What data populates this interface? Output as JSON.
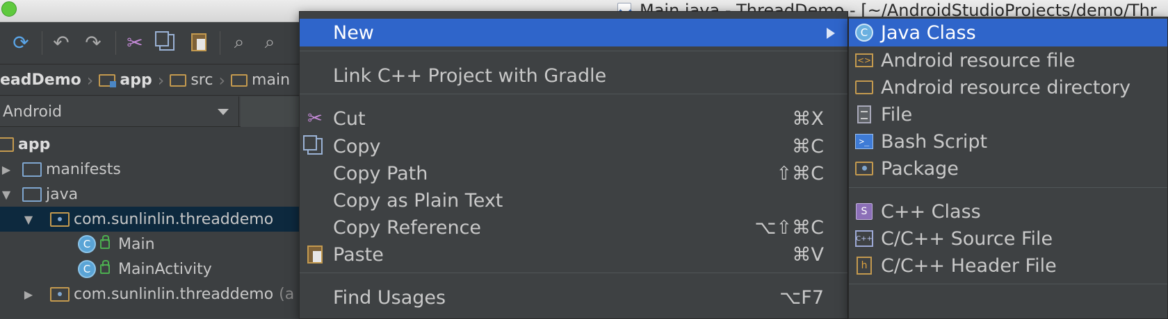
{
  "window": {
    "title": "Main.java - ThreadDemo - [~/AndroidStudioProjects/demo/Thr"
  },
  "toolbar": {
    "icons": [
      "sync-icon",
      "undo-icon",
      "redo-icon",
      "cut-icon",
      "copy-icon",
      "paste-icon",
      "find-icon",
      "replace-icon"
    ]
  },
  "breadcrumb": {
    "items": [
      "eadDemo",
      "app",
      "src",
      "main"
    ]
  },
  "project_panel": {
    "view_selector": "Android",
    "tree": [
      {
        "label": "app",
        "icon": "app-folder-icon"
      },
      {
        "label": "manifests",
        "icon": "folder-icon"
      },
      {
        "label": "java",
        "icon": "folder-icon"
      },
      {
        "label": "com.sunlinlin.threaddemo",
        "icon": "package-icon",
        "selected": true
      },
      {
        "label": "Main",
        "icon": "class-icon"
      },
      {
        "label": "MainActivity",
        "icon": "class-icon"
      },
      {
        "label": "com.sunlinlin.threaddemo",
        "suffix": "(a",
        "icon": "package-icon"
      }
    ]
  },
  "context_menu": {
    "items": [
      {
        "label": "New",
        "shortcut": "",
        "submenu": true,
        "highlighted": true
      },
      {
        "label": "Link C++ Project with Gradle",
        "shortcut": ""
      },
      {
        "label": "Cut",
        "shortcut": "⌘X",
        "icon": "scissors-icon"
      },
      {
        "label": "Copy",
        "shortcut": "⌘C",
        "icon": "copy-icon"
      },
      {
        "label": "Copy Path",
        "shortcut": "⇧⌘C"
      },
      {
        "label": "Copy as Plain Text",
        "shortcut": ""
      },
      {
        "label": "Copy Reference",
        "shortcut": "⌥⇧⌘C"
      },
      {
        "label": "Paste",
        "shortcut": "⌘V",
        "icon": "paste-icon"
      },
      {
        "label": "Find Usages",
        "shortcut": "⌥F7"
      }
    ]
  },
  "new_submenu": {
    "items": [
      {
        "label": "Java Class",
        "icon": "java-class-icon",
        "highlighted": true
      },
      {
        "label": "Android resource file",
        "icon": "resource-file-icon"
      },
      {
        "label": "Android resource directory",
        "icon": "folder-icon"
      },
      {
        "label": "File",
        "icon": "file-icon"
      },
      {
        "label": "Bash Script",
        "icon": "bash-script-icon"
      },
      {
        "label": "Package",
        "icon": "package-icon"
      },
      {
        "label": "C++ Class",
        "icon": "cpp-class-icon"
      },
      {
        "label": "C/C++ Source File",
        "icon": "cpp-source-icon"
      },
      {
        "label": "C/C++ Header File",
        "icon": "cpp-header-icon"
      }
    ]
  },
  "colors": {
    "highlight": "#2f65ca",
    "menu_bg": "#3e4143",
    "panel_bg": "#3c3f41",
    "selection": "#0d293e"
  }
}
